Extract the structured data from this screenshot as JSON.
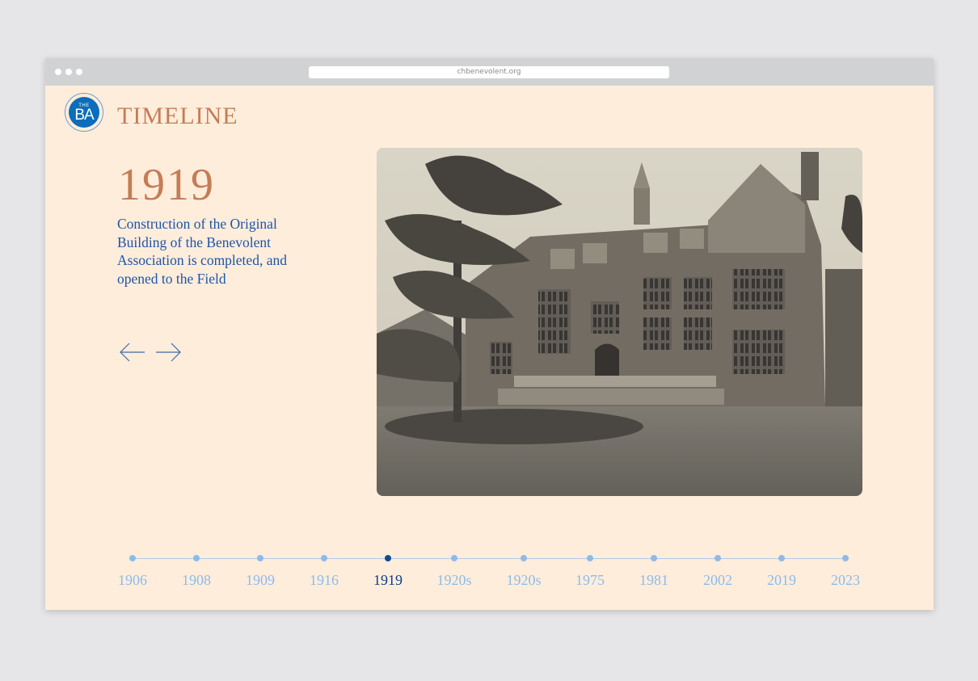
{
  "browser": {
    "url": "chbenevolent.org",
    "window_dots": 3
  },
  "logo": {
    "top_text": "THE",
    "main_text": "BA"
  },
  "header": {
    "title": "TIMELINE"
  },
  "entry": {
    "year": "1919",
    "description": "Construction of the Original Building of the Benevolent Association is completed, and opened to the Field",
    "image_alt": "Historic black-and-white photograph of a large Tudor-style brick building with a pine tree in front"
  },
  "navigation": {
    "prev_icon": "arrow-left-icon",
    "next_icon": "arrow-right-icon"
  },
  "timeline": {
    "active_index": 4,
    "items": [
      {
        "label": "1906"
      },
      {
        "label": "1908"
      },
      {
        "label": "1909"
      },
      {
        "label": "1916"
      },
      {
        "label": "1919"
      },
      {
        "label": "1920s"
      },
      {
        "label": "1920s"
      },
      {
        "label": "1975"
      },
      {
        "label": "1981"
      },
      {
        "label": "2002"
      },
      {
        "label": "2019"
      },
      {
        "label": "2023"
      }
    ]
  },
  "colors": {
    "background": "#ffeddb",
    "title_accent": "#c57c56",
    "body_text": "#1d55a5",
    "timeline_inactive": "#8bbce9",
    "timeline_active": "#0f3e85",
    "logo_blue": "#0b6dbb"
  }
}
